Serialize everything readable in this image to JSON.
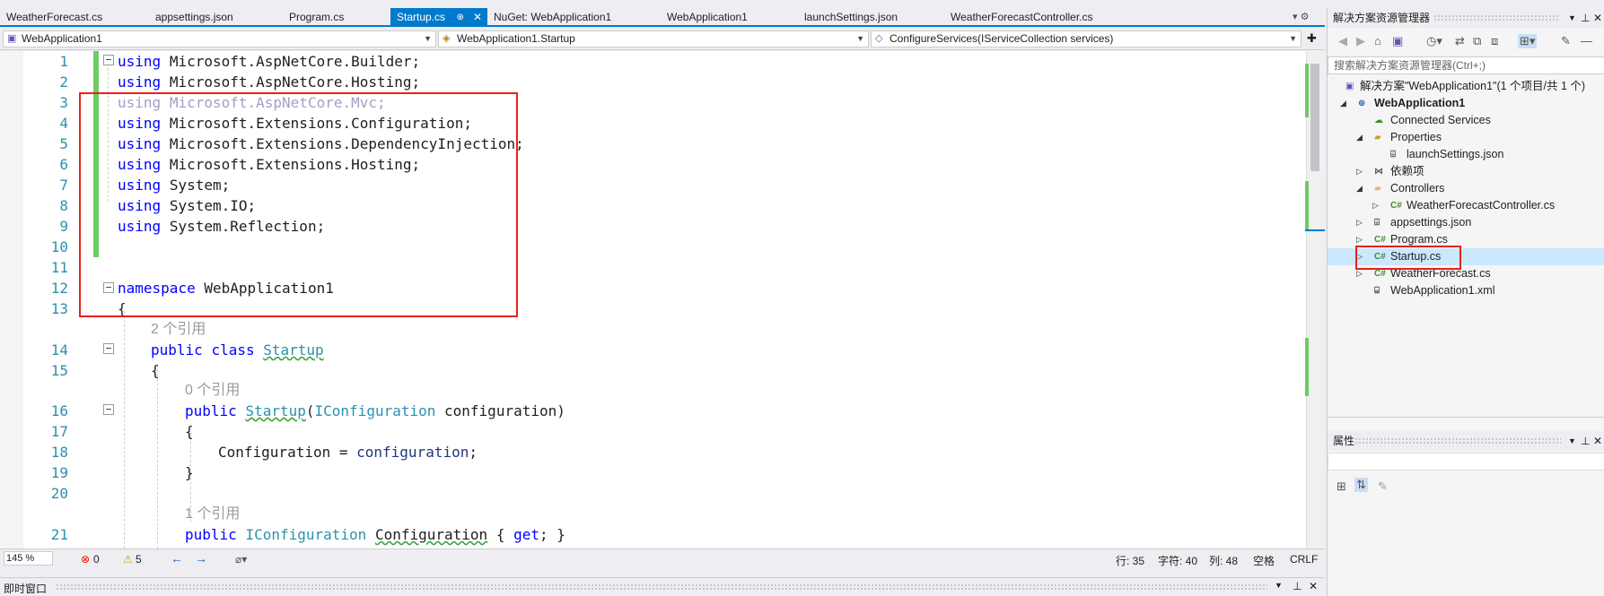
{
  "tabs": [
    {
      "label": "WeatherForecast.cs"
    },
    {
      "label": "appsettings.json"
    },
    {
      "label": "Program.cs"
    },
    {
      "label": "Startup.cs",
      "pin": "⊕",
      "close": "✕"
    },
    {
      "label": "NuGet: WebApplication1"
    },
    {
      "label": "WebApplication1"
    },
    {
      "label": "launchSettings.json"
    },
    {
      "label": "WeatherForecastController.cs"
    }
  ],
  "tab_tools": "▾ ⚙",
  "nav": {
    "project": "WebApplication1",
    "type": "WebApplication1.Startup",
    "member": "ConfigureServices(IServiceCollection services)"
  },
  "code": {
    "line_numbers": [
      "1",
      "2",
      "3",
      "4",
      "5",
      "6",
      "7",
      "8",
      "9",
      "10",
      "11",
      "12",
      "13",
      "14",
      "15",
      "16",
      "17",
      "18",
      "19",
      "20",
      "21"
    ],
    "kw_using": "using",
    "ns1": "Microsoft.AspNetCore.Builder;",
    "ns2": "Microsoft.AspNetCore.Hosting;",
    "ns3": "Microsoft.AspNetCore.Mvc;",
    "ns4": "Microsoft.Extensions.Configuration;",
    "ns5": "Microsoft.Extensions.DependencyInjection;",
    "ns6": "Microsoft.Extensions.Hosting;",
    "ns7": "System;",
    "ns8": "System.IO;",
    "ns9": "System.Reflection;",
    "kw_namespace": "namespace",
    "ns_name": "WebApplication1",
    "brace_open": "{",
    "brace_close": "}",
    "ref2": "2 个引用",
    "kw_public": "public",
    "kw_class": "class",
    "class_name": "Startup",
    "ref0": "0 个引用",
    "ctor_name": "Startup",
    "paren_open": "(",
    "param_type": "IConfiguration",
    "param_name": "configuration",
    "paren_close": ")",
    "assign_lhs": "Configuration = ",
    "assign_rhs": "configuration",
    "semi": ";",
    "ref1": "1 个引用",
    "prop_type": "IConfiguration",
    "prop_name": "Configuration",
    "prop_body_open": "{ ",
    "kw_get": "get",
    "prop_body_close": "; }"
  },
  "status": {
    "zoom": "145 %",
    "errors": "0",
    "warnings": "5",
    "row": "行: 35",
    "char": "字符: 40",
    "col": "列: 48",
    "spaces": "空格",
    "eol": "CRLF"
  },
  "bottom_panel": {
    "title": "即时窗口"
  },
  "solution_explorer": {
    "title": "解决方案资源管理器",
    "search_placeholder": "搜索解决方案资源管理器(Ctrl+;)",
    "items": [
      {
        "label": "解决方案\"WebApplication1\"(1 个项目/共 1 个)"
      },
      {
        "label": "WebApplication1"
      },
      {
        "label": "Connected Services"
      },
      {
        "label": "Properties"
      },
      {
        "label": "launchSettings.json"
      },
      {
        "label": "依赖项"
      },
      {
        "label": "Controllers"
      },
      {
        "label": "WeatherForecastController.cs"
      },
      {
        "label": "appsettings.json"
      },
      {
        "label": "Program.cs"
      },
      {
        "label": "Startup.cs"
      },
      {
        "label": "WeatherForecast.cs"
      },
      {
        "label": "WebApplication1.xml"
      }
    ],
    "cs_badge": "C#"
  },
  "properties": {
    "title": "属性"
  },
  "colors": {
    "accent": "#007acc",
    "highlight": "#e8201e",
    "change_bar": "#6ecb64"
  }
}
